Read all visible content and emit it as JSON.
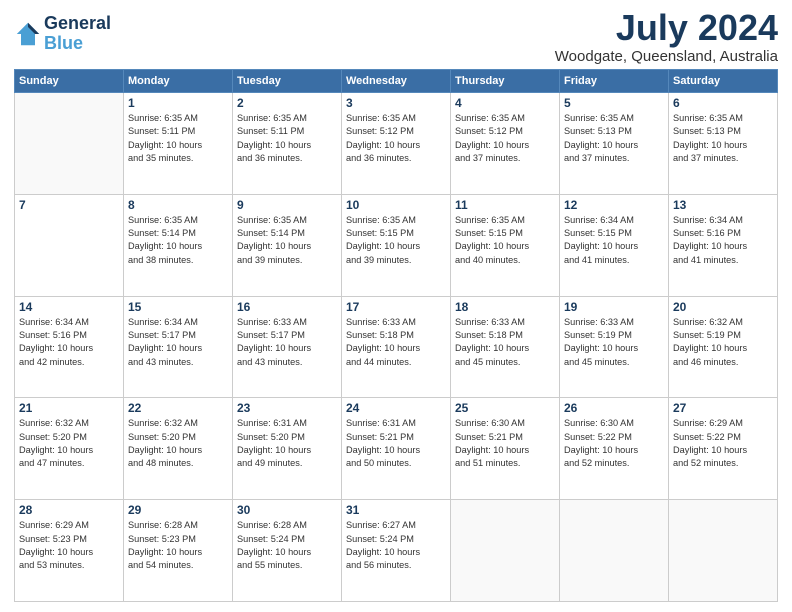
{
  "logo": {
    "line1": "General",
    "line2": "Blue"
  },
  "title": "July 2024",
  "location": "Woodgate, Queensland, Australia",
  "weekdays": [
    "Sunday",
    "Monday",
    "Tuesday",
    "Wednesday",
    "Thursday",
    "Friday",
    "Saturday"
  ],
  "weeks": [
    [
      {
        "day": "",
        "info": ""
      },
      {
        "day": "1",
        "info": "Sunrise: 6:35 AM\nSunset: 5:11 PM\nDaylight: 10 hours\nand 35 minutes."
      },
      {
        "day": "2",
        "info": "Sunrise: 6:35 AM\nSunset: 5:11 PM\nDaylight: 10 hours\nand 36 minutes."
      },
      {
        "day": "3",
        "info": "Sunrise: 6:35 AM\nSunset: 5:12 PM\nDaylight: 10 hours\nand 36 minutes."
      },
      {
        "day": "4",
        "info": "Sunrise: 6:35 AM\nSunset: 5:12 PM\nDaylight: 10 hours\nand 37 minutes."
      },
      {
        "day": "5",
        "info": "Sunrise: 6:35 AM\nSunset: 5:13 PM\nDaylight: 10 hours\nand 37 minutes."
      },
      {
        "day": "6",
        "info": "Sunrise: 6:35 AM\nSunset: 5:13 PM\nDaylight: 10 hours\nand 37 minutes."
      }
    ],
    [
      {
        "day": "7",
        "info": ""
      },
      {
        "day": "8",
        "info": "Sunrise: 6:35 AM\nSunset: 5:14 PM\nDaylight: 10 hours\nand 38 minutes."
      },
      {
        "day": "9",
        "info": "Sunrise: 6:35 AM\nSunset: 5:14 PM\nDaylight: 10 hours\nand 39 minutes."
      },
      {
        "day": "10",
        "info": "Sunrise: 6:35 AM\nSunset: 5:15 PM\nDaylight: 10 hours\nand 39 minutes."
      },
      {
        "day": "11",
        "info": "Sunrise: 6:35 AM\nSunset: 5:15 PM\nDaylight: 10 hours\nand 40 minutes."
      },
      {
        "day": "12",
        "info": "Sunrise: 6:34 AM\nSunset: 5:15 PM\nDaylight: 10 hours\nand 41 minutes."
      },
      {
        "day": "13",
        "info": "Sunrise: 6:34 AM\nSunset: 5:16 PM\nDaylight: 10 hours\nand 41 minutes."
      }
    ],
    [
      {
        "day": "14",
        "info": "Sunrise: 6:34 AM\nSunset: 5:16 PM\nDaylight: 10 hours\nand 42 minutes."
      },
      {
        "day": "15",
        "info": "Sunrise: 6:34 AM\nSunset: 5:17 PM\nDaylight: 10 hours\nand 43 minutes."
      },
      {
        "day": "16",
        "info": "Sunrise: 6:33 AM\nSunset: 5:17 PM\nDaylight: 10 hours\nand 43 minutes."
      },
      {
        "day": "17",
        "info": "Sunrise: 6:33 AM\nSunset: 5:18 PM\nDaylight: 10 hours\nand 44 minutes."
      },
      {
        "day": "18",
        "info": "Sunrise: 6:33 AM\nSunset: 5:18 PM\nDaylight: 10 hours\nand 45 minutes."
      },
      {
        "day": "19",
        "info": "Sunrise: 6:33 AM\nSunset: 5:19 PM\nDaylight: 10 hours\nand 45 minutes."
      },
      {
        "day": "20",
        "info": "Sunrise: 6:32 AM\nSunset: 5:19 PM\nDaylight: 10 hours\nand 46 minutes."
      }
    ],
    [
      {
        "day": "21",
        "info": "Sunrise: 6:32 AM\nSunset: 5:20 PM\nDaylight: 10 hours\nand 47 minutes."
      },
      {
        "day": "22",
        "info": "Sunrise: 6:32 AM\nSunset: 5:20 PM\nDaylight: 10 hours\nand 48 minutes."
      },
      {
        "day": "23",
        "info": "Sunrise: 6:31 AM\nSunset: 5:20 PM\nDaylight: 10 hours\nand 49 minutes."
      },
      {
        "day": "24",
        "info": "Sunrise: 6:31 AM\nSunset: 5:21 PM\nDaylight: 10 hours\nand 50 minutes."
      },
      {
        "day": "25",
        "info": "Sunrise: 6:30 AM\nSunset: 5:21 PM\nDaylight: 10 hours\nand 51 minutes."
      },
      {
        "day": "26",
        "info": "Sunrise: 6:30 AM\nSunset: 5:22 PM\nDaylight: 10 hours\nand 52 minutes."
      },
      {
        "day": "27",
        "info": "Sunrise: 6:29 AM\nSunset: 5:22 PM\nDaylight: 10 hours\nand 52 minutes."
      }
    ],
    [
      {
        "day": "28",
        "info": "Sunrise: 6:29 AM\nSunset: 5:23 PM\nDaylight: 10 hours\nand 53 minutes."
      },
      {
        "day": "29",
        "info": "Sunrise: 6:28 AM\nSunset: 5:23 PM\nDaylight: 10 hours\nand 54 minutes."
      },
      {
        "day": "30",
        "info": "Sunrise: 6:28 AM\nSunset: 5:24 PM\nDaylight: 10 hours\nand 55 minutes."
      },
      {
        "day": "31",
        "info": "Sunrise: 6:27 AM\nSunset: 5:24 PM\nDaylight: 10 hours\nand 56 minutes."
      },
      {
        "day": "",
        "info": ""
      },
      {
        "day": "",
        "info": ""
      },
      {
        "day": "",
        "info": ""
      }
    ]
  ]
}
